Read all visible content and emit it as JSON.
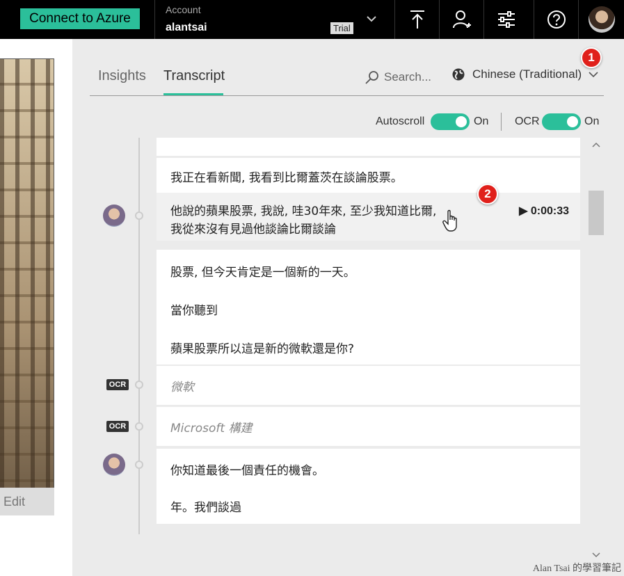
{
  "topbar": {
    "connect_label": "Connect to Azure",
    "account_label": "Account",
    "account_name": "alantsai",
    "trial_badge": "Trial",
    "icons": [
      "upload-icon",
      "add-user-icon",
      "settings-sliders-icon",
      "help-icon",
      "user-avatar"
    ]
  },
  "left": {
    "edit_label": "Edit"
  },
  "tabs": [
    {
      "label": "Insights"
    },
    {
      "label": "Transcript",
      "active": true
    }
  ],
  "search": {
    "placeholder": "Search..."
  },
  "language": {
    "selected": "Chinese (Traditional)"
  },
  "badges": [
    "1",
    "2"
  ],
  "toggles": {
    "autoscroll_label": "Autoscroll",
    "autoscroll_state": "On",
    "ocr_label": "OCR",
    "ocr_state": "On"
  },
  "transcript": [
    {
      "lines": [
        "我正在看新聞, 我看到比爾蓋茨在談論股票。"
      ]
    },
    {
      "lines": [
        "他說的蘋果股票, 我說, 哇30年來, 至少我知道比爾,",
        "我從來沒有見過他談論比爾談論"
      ],
      "time": "0:00:33",
      "highlighted": true
    },
    {
      "lines": [
        "股票, 但今天肯定是一個新的一天。",
        "當你聽到",
        "蘋果股票所以這是新的微軟還是你?"
      ]
    },
    {
      "ocr_tag": "OCR",
      "lines": [
        "微軟"
      ]
    },
    {
      "ocr_tag": "OCR",
      "lines": [
        "Microsoft 構建"
      ]
    },
    {
      "lines": [
        "你知道最後一個責任的機會。",
        "年。我們談過"
      ]
    }
  ],
  "colors": {
    "accent": "#2bbf9a",
    "badge": "#e0201b",
    "topbar": "#000000"
  },
  "watermark": "Alan Tsai 的學習筆記"
}
